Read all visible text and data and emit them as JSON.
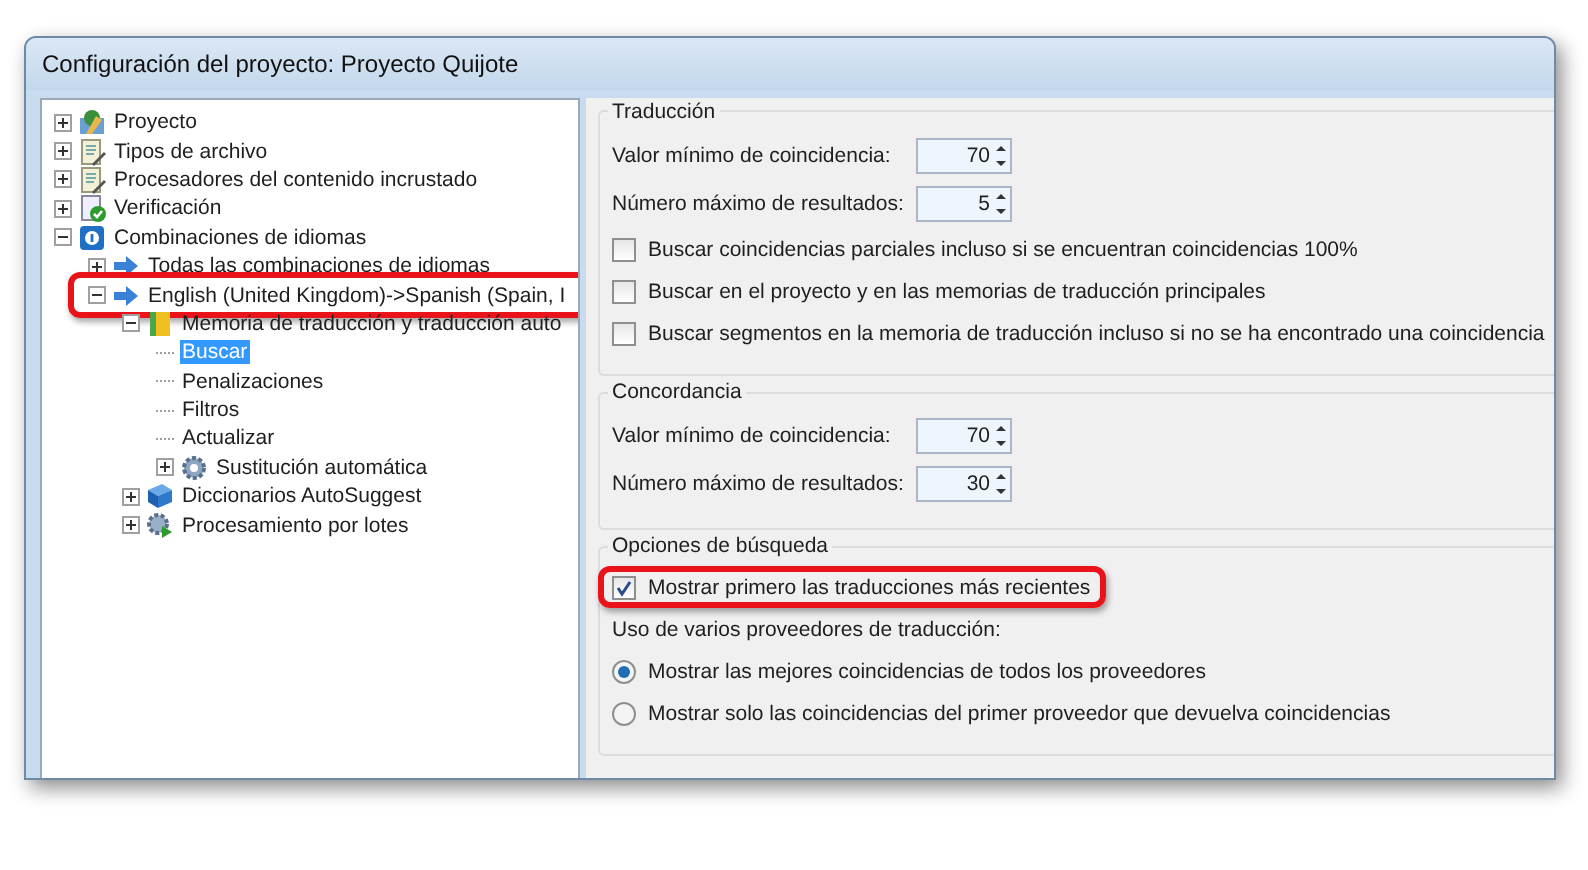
{
  "window": {
    "title": "Configuración del proyecto: Proyecto Quijote"
  },
  "tree": [
    {
      "label": "Proyecto",
      "kind": "project",
      "expanded": false,
      "selected": false,
      "highlighted": false
    },
    {
      "label": "Tipos de archivo",
      "kind": "filetype",
      "expanded": false,
      "selected": false,
      "highlighted": false
    },
    {
      "label": "Procesadores del contenido incrustado",
      "kind": "filetype",
      "expanded": false,
      "selected": false,
      "highlighted": false
    },
    {
      "label": "Verificación",
      "kind": "check",
      "expanded": false,
      "selected": false,
      "highlighted": false
    },
    {
      "label": "Combinaciones de idiomas",
      "kind": "language",
      "expanded": true,
      "selected": false,
      "highlighted": false,
      "children": [
        {
          "label": "Todas las combinaciones de idiomas",
          "kind": "pair",
          "expanded": false,
          "selected": false,
          "highlighted": false
        },
        {
          "label": "English (United Kingdom)->Spanish (Spain, I",
          "kind": "pair",
          "expanded": true,
          "selected": false,
          "highlighted": true,
          "children": [
            {
              "label": "Memoria de traducción y traducción auto",
              "kind": "memory",
              "expanded": true,
              "selected": false,
              "highlighted": false,
              "children": [
                {
                  "label": "Buscar",
                  "kind": "leaf",
                  "selected": true,
                  "highlighted": false
                },
                {
                  "label": "Penalizaciones",
                  "kind": "leaf",
                  "selected": false,
                  "highlighted": false
                },
                {
                  "label": "Filtros",
                  "kind": "leaf",
                  "selected": false,
                  "highlighted": false
                },
                {
                  "label": "Actualizar",
                  "kind": "leaf",
                  "selected": false,
                  "highlighted": false
                },
                {
                  "label": "Sustitución automática",
                  "kind": "gear",
                  "expanded": false,
                  "selected": false,
                  "highlighted": false
                }
              ]
            },
            {
              "label": "Diccionarios AutoSuggest",
              "kind": "dictionary",
              "expanded": false,
              "selected": false,
              "highlighted": false
            },
            {
              "label": "Procesamiento por lotes",
              "kind": "batch",
              "expanded": false,
              "selected": false,
              "highlighted": false
            }
          ]
        }
      ]
    }
  ],
  "groups": [
    {
      "title": "Traducción",
      "items": [
        {
          "kind": "spinner",
          "label": "Valor mínimo de coincidencia:",
          "value": "70"
        },
        {
          "kind": "spinner",
          "label": "Número máximo de resultados:",
          "value": "5"
        },
        {
          "kind": "checkbox",
          "label": "Buscar coincidencias parciales incluso si se encuentran coincidencias 100%",
          "checked": false,
          "highlighted": false
        },
        {
          "kind": "checkbox",
          "label": "Buscar en el proyecto y en las memorias de traducción principales",
          "checked": false,
          "highlighted": false
        },
        {
          "kind": "checkbox",
          "label": "Buscar segmentos en la memoria de traducción incluso si no se ha encontrado una coincidencia",
          "checked": false,
          "highlighted": false
        }
      ]
    },
    {
      "title": "Concordancia",
      "items": [
        {
          "kind": "spinner",
          "label": "Valor mínimo de coincidencia:",
          "value": "70"
        },
        {
          "kind": "spinner",
          "label": "Número máximo de resultados:",
          "value": "30"
        }
      ]
    },
    {
      "title": "Opciones de búsqueda",
      "items": [
        {
          "kind": "checkbox",
          "label": "Mostrar primero las traducciones más recientes",
          "checked": true,
          "highlighted": true
        },
        {
          "kind": "text",
          "label": "Uso de varios proveedores de traducción:"
        },
        {
          "kind": "radio",
          "label": "Mostrar las mejores coincidencias de todos los proveedores",
          "selected": true
        },
        {
          "kind": "radio",
          "label": "Mostrar solo las coincidencias del primer proveedor que devuelva coincidencias",
          "selected": false
        }
      ]
    }
  ]
}
